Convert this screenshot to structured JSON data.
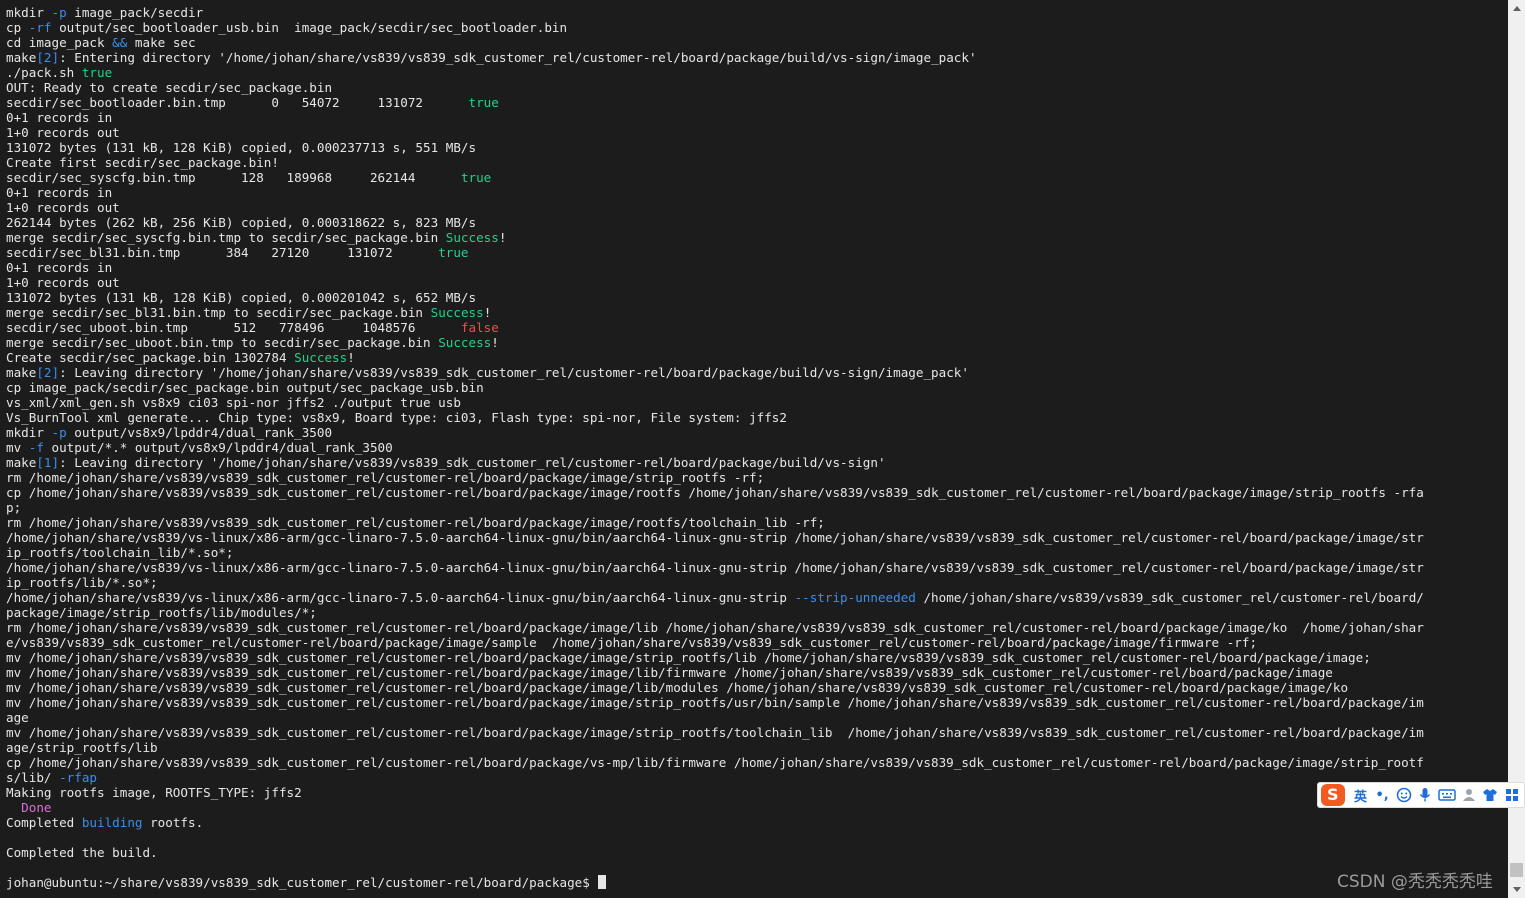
{
  "terminal": {
    "lines": [
      [
        {
          "t": "mkdir "
        },
        {
          "t": "-p",
          "c": "kw"
        },
        {
          "t": " image_pack/secdir"
        }
      ],
      [
        {
          "t": "cp "
        },
        {
          "t": "-rf",
          "c": "kw"
        },
        {
          "t": " output/sec_bootloader_usb.bin  image_pack/secdir/sec_bootloader.bin"
        }
      ],
      [
        {
          "t": "cd image_pack "
        },
        {
          "t": "&&",
          "c": "kw"
        },
        {
          "t": " make sec"
        }
      ],
      [
        {
          "t": "make"
        },
        {
          "t": "[2]",
          "c": "kw"
        },
        {
          "t": ": Entering directory '/home/johan/share/vs839/vs839_sdk_customer_rel/customer-rel/board/package/build/vs-sign/image_pack'"
        }
      ],
      [
        {
          "t": "./pack.sh "
        },
        {
          "t": "true",
          "c": "ok"
        }
      ],
      [
        {
          "t": "OUT: Ready to create secdir/sec_package.bin"
        }
      ],
      [
        {
          "t": "secdir/sec_bootloader.bin.tmp      0   54072     131072      "
        },
        {
          "t": "true",
          "c": "ok"
        }
      ],
      [
        {
          "t": "0+1 records in"
        }
      ],
      [
        {
          "t": "1+0 records out"
        }
      ],
      [
        {
          "t": "131072 bytes (131 kB, 128 KiB) copied, 0.000237713 s, 551 MB/s"
        }
      ],
      [
        {
          "t": "Create first secdir/sec_package.bin!"
        }
      ],
      [
        {
          "t": "secdir/sec_syscfg.bin.tmp      128   189968     262144      "
        },
        {
          "t": "true",
          "c": "ok"
        }
      ],
      [
        {
          "t": "0+1 records in"
        }
      ],
      [
        {
          "t": "1+0 records out"
        }
      ],
      [
        {
          "t": "262144 bytes (262 kB, 256 KiB) copied, 0.000318622 s, 823 MB/s"
        }
      ],
      [
        {
          "t": "merge secdir/sec_syscfg.bin.tmp to secdir/sec_package.bin "
        },
        {
          "t": "Success",
          "c": "ok"
        },
        {
          "t": "!"
        }
      ],
      [
        {
          "t": "secdir/sec_bl31.bin.tmp      384   27120     131072      "
        },
        {
          "t": "true",
          "c": "ok"
        }
      ],
      [
        {
          "t": "0+1 records in"
        }
      ],
      [
        {
          "t": "1+0 records out"
        }
      ],
      [
        {
          "t": "131072 bytes (131 kB, 128 KiB) copied, 0.000201042 s, 652 MB/s"
        }
      ],
      [
        {
          "t": "merge secdir/sec_bl31.bin.tmp to secdir/sec_package.bin "
        },
        {
          "t": "Success",
          "c": "ok"
        },
        {
          "t": "!"
        }
      ],
      [
        {
          "t": "secdir/sec_uboot.bin.tmp      512   778496     1048576      "
        },
        {
          "t": "false",
          "c": "bad"
        }
      ],
      [
        {
          "t": "merge secdir/sec_uboot.bin.tmp to secdir/sec_package.bin "
        },
        {
          "t": "Success",
          "c": "ok"
        },
        {
          "t": "!"
        }
      ],
      [
        {
          "t": "Create secdir/sec_package.bin 1302784 "
        },
        {
          "t": "Success",
          "c": "ok"
        },
        {
          "t": "!"
        }
      ],
      [
        {
          "t": "make"
        },
        {
          "t": "[2]",
          "c": "kw"
        },
        {
          "t": ": Leaving directory '/home/johan/share/vs839/vs839_sdk_customer_rel/customer-rel/board/package/build/vs-sign/image_pack'"
        }
      ],
      [
        {
          "t": "cp image_pack/secdir/sec_package.bin output/sec_package_usb.bin"
        }
      ],
      [
        {
          "t": "vs_xml/xml_gen.sh vs8x9 ci03 spi-nor jffs2 ./output true usb"
        }
      ],
      [
        {
          "t": "Vs_BurnTool xml generate... Chip type: vs8x9, Board type: ci03, Flash type: spi-nor, File system: jffs2"
        }
      ],
      [
        {
          "t": "mkdir "
        },
        {
          "t": "-p",
          "c": "kw"
        },
        {
          "t": " output/vs8x9/lpddr4/dual_rank_3500"
        }
      ],
      [
        {
          "t": "mv "
        },
        {
          "t": "-f",
          "c": "kw"
        },
        {
          "t": " output/*.* output/vs8x9/lpddr4/dual_rank_3500"
        }
      ],
      [
        {
          "t": "make"
        },
        {
          "t": "[1]",
          "c": "kw"
        },
        {
          "t": ": Leaving directory '/home/johan/share/vs839/vs839_sdk_customer_rel/customer-rel/board/package/build/vs-sign'"
        }
      ],
      [
        {
          "t": "rm /home/johan/share/vs839/vs839_sdk_customer_rel/customer-rel/board/package/image/strip_rootfs -rf;"
        }
      ],
      [
        {
          "t": "cp /home/johan/share/vs839/vs839_sdk_customer_rel/customer-rel/board/package/image/rootfs /home/johan/share/vs839/vs839_sdk_customer_rel/customer-rel/board/package/image/strip_rootfs -rfa"
        }
      ],
      [
        {
          "t": "p;"
        }
      ],
      [
        {
          "t": "rm /home/johan/share/vs839/vs839_sdk_customer_rel/customer-rel/board/package/image/rootfs/toolchain_lib -rf;"
        }
      ],
      [
        {
          "t": "/home/johan/share/vs839/vs-linux/x86-arm/gcc-linaro-7.5.0-aarch64-linux-gnu/bin/aarch64-linux-gnu-strip /home/johan/share/vs839/vs839_sdk_customer_rel/customer-rel/board/package/image/str"
        }
      ],
      [
        {
          "t": "ip_rootfs/toolchain_lib/*.so*;"
        }
      ],
      [
        {
          "t": "/home/johan/share/vs839/vs-linux/x86-arm/gcc-linaro-7.5.0-aarch64-linux-gnu/bin/aarch64-linux-gnu-strip /home/johan/share/vs839/vs839_sdk_customer_rel/customer-rel/board/package/image/str"
        }
      ],
      [
        {
          "t": "ip_rootfs/lib/*.so*;"
        }
      ],
      [
        {
          "t": "/home/johan/share/vs839/vs-linux/x86-arm/gcc-linaro-7.5.0-aarch64-linux-gnu/bin/aarch64-linux-gnu-strip "
        },
        {
          "t": "--strip-unneeded",
          "c": "kw"
        },
        {
          "t": " /home/johan/share/vs839/vs839_sdk_customer_rel/customer-rel/board/"
        }
      ],
      [
        {
          "t": "package/image/strip_rootfs/lib/modules/*;"
        }
      ],
      [
        {
          "t": "rm /home/johan/share/vs839/vs839_sdk_customer_rel/customer-rel/board/package/image/lib /home/johan/share/vs839/vs839_sdk_customer_rel/customer-rel/board/package/image/ko  /home/johan/shar"
        }
      ],
      [
        {
          "t": "e/vs839/vs839_sdk_customer_rel/customer-rel/board/package/image/sample  /home/johan/share/vs839/vs839_sdk_customer_rel/customer-rel/board/package/image/firmware -rf;"
        }
      ],
      [
        {
          "t": "mv /home/johan/share/vs839/vs839_sdk_customer_rel/customer-rel/board/package/image/strip_rootfs/lib /home/johan/share/vs839/vs839_sdk_customer_rel/customer-rel/board/package/image;"
        }
      ],
      [
        {
          "t": "mv /home/johan/share/vs839/vs839_sdk_customer_rel/customer-rel/board/package/image/lib/firmware /home/johan/share/vs839/vs839_sdk_customer_rel/customer-rel/board/package/image"
        }
      ],
      [
        {
          "t": "mv /home/johan/share/vs839/vs839_sdk_customer_rel/customer-rel/board/package/image/lib/modules /home/johan/share/vs839/vs839_sdk_customer_rel/customer-rel/board/package/image/ko"
        }
      ],
      [
        {
          "t": "mv /home/johan/share/vs839/vs839_sdk_customer_rel/customer-rel/board/package/image/strip_rootfs/usr/bin/sample /home/johan/share/vs839/vs839_sdk_customer_rel/customer-rel/board/package/im"
        }
      ],
      [
        {
          "t": "age"
        }
      ],
      [
        {
          "t": "mv /home/johan/share/vs839/vs839_sdk_customer_rel/customer-rel/board/package/image/strip_rootfs/toolchain_lib  /home/johan/share/vs839/vs839_sdk_customer_rel/customer-rel/board/package/im"
        }
      ],
      [
        {
          "t": "age/strip_rootfs/lib"
        }
      ],
      [
        {
          "t": "cp /home/johan/share/vs839/vs839_sdk_customer_rel/customer-rel/board/package/vs-mp/lib/firmware /home/johan/share/vs839/vs839_sdk_customer_rel/customer-rel/board/package/image/strip_rootf"
        }
      ],
      [
        {
          "t": "s/lib/ "
        },
        {
          "t": "-rfap",
          "c": "kw"
        }
      ],
      [
        {
          "t": "Making rootfs image, ROOTFS_TYPE: jffs2"
        }
      ],
      [
        {
          "t": "  "
        },
        {
          "t": "Done",
          "c": "mag"
        }
      ],
      [
        {
          "t": "Completed "
        },
        {
          "t": "building",
          "c": "kw"
        },
        {
          "t": " rootfs."
        }
      ],
      [
        {
          "t": ""
        }
      ],
      [
        {
          "t": "Completed the build."
        }
      ],
      [
        {
          "t": ""
        }
      ],
      [
        {
          "t": "johan@ubuntu:~/share/vs839/vs839_sdk_customer_rel/customer-rel/board/package$ "
        }
      ]
    ]
  },
  "colors": {
    "background": "#1c1c1c",
    "foreground": "#e6e6e6",
    "keyword_blue": "#3b8eea",
    "success_green": "#23d18b",
    "error_red": "#f14c4c",
    "magenta": "#d670d6"
  },
  "ime_toolbar": {
    "logo_icon": "sogou-s-icon",
    "lang_label": "英",
    "punct_label": "•,",
    "icons": [
      "emoji-icon",
      "microphone-icon",
      "keyboard-icon",
      "user-icon",
      "skin-icon",
      "grid-icon"
    ]
  },
  "watermark": {
    "text": "CSDN @秃秃秃秃哇"
  }
}
